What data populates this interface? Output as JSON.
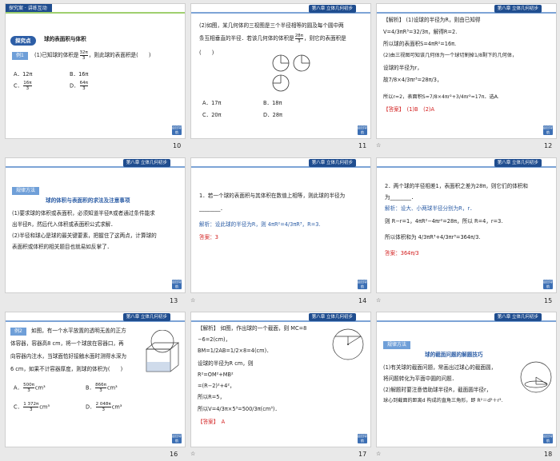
{
  "colors": {
    "accent": "#1f4d8f",
    "answer": "#d21c1c",
    "blue_text": "#2d5ea6",
    "highlight": "#5b8fd3"
  },
  "chapter_label": "第八章  立体几何初步",
  "slides": [
    {
      "number": "10",
      "tag": "探究案",
      "tag2": "讲练互动",
      "heading": "球的表面积与体积",
      "example_badge": "例1",
      "q1": "(1)已知球的体积是",
      "q1_frac_num": "32π",
      "q1_frac_den": "3",
      "q1_rest": "，则此球的表面积是(　　)",
      "options": [
        {
          "label": "A．12π"
        },
        {
          "label": "B．16π"
        },
        {
          "label": "C．",
          "frac_num": "16π",
          "frac_den": "3"
        },
        {
          "label": "D．",
          "frac_num": "64π",
          "frac_den": "3"
        }
      ]
    },
    {
      "number": "11",
      "line1": "(2)如图，某几何体的三视图是三个半径相等的圆及每个圆中两",
      "line2a": "条互相垂直的半径．若该几何体的体积是",
      "frac_num": "28π",
      "frac_den": "3",
      "line2b": "，则它的表面积是",
      "line3": "(　　)",
      "options": [
        "A．17π",
        "B．18π",
        "C．20π",
        "D．28π"
      ]
    },
    {
      "number": "12",
      "analysis": "【解析】",
      "l1": "(1)设球的半径为R，则由已知得",
      "l2": "V=4/3πR³=32/3π，解得R=2.",
      "l3": "所以球的表面积S=4πR²=16π.",
      "l4": "(2)由三视图可知该几何体为一个球切割掉1/8剩下的几何体，",
      "l5": "设球的半径为r，",
      "l6": "故7/8×4/3πr³=28π/3，",
      "l7": "所以r=2，表面积S=7/8×4πr²+3/4πr²=17π．选A.",
      "answer": "【答案】　(1)B　(2)A"
    },
    {
      "number": "13",
      "tag": "规律方法",
      "heading": "球的体积与表面积的求法及注意事项",
      "l1": "(1)要求球的体积或表面积，必须知道半径R或者通过条件能求",
      "l2": "出半径R，然后代入体积或表面积公式求解．",
      "l3": "(2)半径和球心是球的最关键要素，把握住了这两点，计算球的",
      "l4": "表面积或体积的相关题目也就易如反掌了．"
    },
    {
      "number": "14",
      "l1": "1．若一个球的表面积与其体积在数值上相等，则此球的半径为",
      "l2": "________．",
      "analysis": "解析：设此球的半径为R，则 4πR²=4/3πR³，R=3.",
      "answer": "答案：3"
    },
    {
      "number": "15",
      "l1": "2．两个球的半径相差1，表面积之差为28π，则它们的体积和",
      "l2": "为________．",
      "a1": "解析：设大、小两球半径分别为R，r．",
      "a2": "则 R−r=1，4πR²−4πr²=28π，所以 R=4，r=3.",
      "a3": "所以体积和为 4/3πR³+4/3πr³=364π/3.",
      "answer": "答案：364π/3"
    },
    {
      "number": "16",
      "badge": "例2",
      "l1": "如图，有一个水平放置的透明无盖的正方",
      "l2": "体容器，容器高8 cm，将一个球放在容器口，再",
      "l3": "向容器内注水，当球面恰好接触水面时测得水深为",
      "l4": "6 cm，如果不计容器厚度，则球的体积为(　　)",
      "options": [
        {
          "label": "A．",
          "frac_num": "500π",
          "frac_den": "3",
          "unit": "cm³"
        },
        {
          "label": "B．",
          "frac_num": "866π",
          "frac_den": "3",
          "unit": "cm³"
        },
        {
          "label": "C．",
          "frac_num": "1 372π",
          "frac_den": "3",
          "unit": "cm³"
        },
        {
          "label": "D．",
          "frac_num": "2 048π",
          "frac_den": "3",
          "unit": "cm³"
        }
      ]
    },
    {
      "number": "17",
      "analysis": "【解析】",
      "l1": "如图，作出球的一个截面，则 MC=8",
      "l2": "−6=2(cm)，",
      "l3": "BM=1/2AB=1/2×8=4(cm)．",
      "l4": "设球的半径为R cm，则",
      "l5": "R²=OM²+MB²",
      "l6": "=(R−2)²+4²，",
      "l7": "所以R=5，",
      "l8": "所以V=4/3π×5³=500/3π(cm³)．",
      "answer": "【答案】　A"
    },
    {
      "number": "18",
      "tag": "规律方法",
      "heading": "球的截面问题的解题技巧",
      "l1": "(1)有关球的截面问题，常画出过球心的截面圆，",
      "l2": "将问题转化为平面中圆的问题．",
      "l3": "(2)解题时要注意借助球半径R，截面圆半径r，",
      "l4": "球心到截面的距离d 构成的直角三角形，即 R²＝d²＋r²."
    }
  ],
  "back_label": "返回导航"
}
